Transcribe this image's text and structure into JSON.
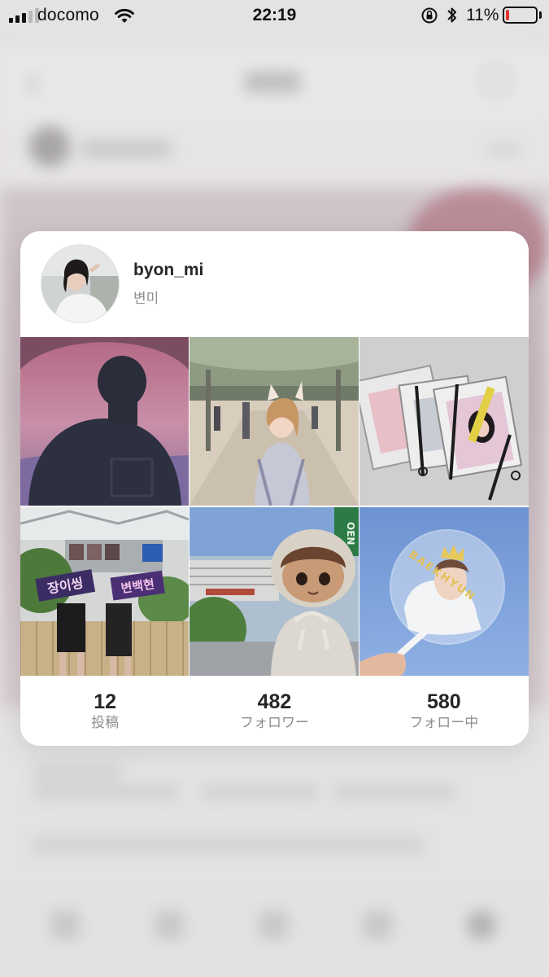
{
  "status_bar": {
    "carrier": "docomo",
    "time": "22:19",
    "battery_percent": "11%",
    "battery_level": 0.11,
    "signal_bars_filled": 3,
    "signal_bars_total": 5,
    "battery_color": "#e0342e"
  },
  "profile_preview": {
    "username": "byon_mi",
    "full_name": "변미",
    "posts": [
      {
        "icon": "photo-silhouette-sunset"
      },
      {
        "icon": "photo-girl-walkway"
      },
      {
        "icon": "photo-pouches-flatlay"
      },
      {
        "icon": "photo-fans-banners"
      },
      {
        "icon": "photo-plush-doll"
      },
      {
        "icon": "photo-hand-fan"
      }
    ],
    "post_texts": {
      "banner_left": "장이씽",
      "banner_right": "변백현",
      "fan_text": "BAEKHYUN",
      "sign_text": "OEN"
    },
    "stats": [
      {
        "count": "12",
        "label": "投稿"
      },
      {
        "count": "482",
        "label": "フォロワー"
      },
      {
        "count": "580",
        "label": "フォロー中"
      }
    ]
  },
  "colors": {
    "card_background": "#ffffff",
    "overlay_background": "#e4e2e3",
    "primary_text": "#262626",
    "secondary_text": "#8e8e8e"
  }
}
